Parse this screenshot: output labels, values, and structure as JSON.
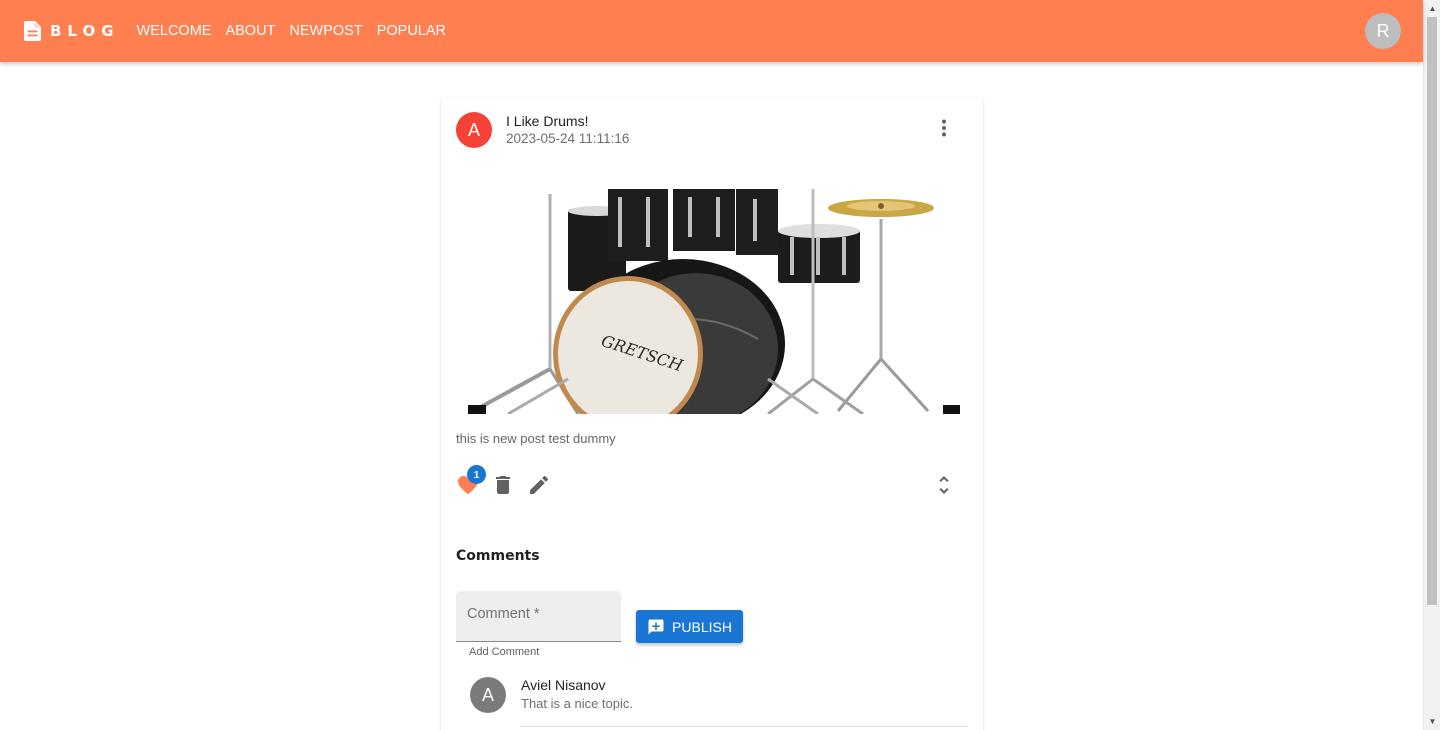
{
  "header": {
    "brand": "BLOG",
    "nav": [
      "WELCOME",
      "ABOUT",
      "NEWPOST",
      "POPULAR"
    ],
    "user_initial": "R",
    "color": "#ff7f50"
  },
  "post": {
    "author_initial": "A",
    "title": "I Like Drums!",
    "date": "2023-05-24 11:11:16",
    "body": "this is new post test dummy",
    "likes": "1",
    "image_brand": "GRETSCH"
  },
  "comments": {
    "title": "Comments",
    "field_label": "Comment *",
    "helper": "Add Comment",
    "publish_label": "PUBLISH",
    "items": [
      {
        "initial": "A",
        "author": "Aviel Nisanov",
        "text": "That is a nice topic."
      }
    ]
  },
  "icons": {
    "brand": "document-icon",
    "more": "more-vert-icon",
    "like": "heart-icon",
    "delete": "trash-icon",
    "edit": "pencil-icon",
    "expand": "unfold-more-icon",
    "publish": "add-comment-icon"
  }
}
